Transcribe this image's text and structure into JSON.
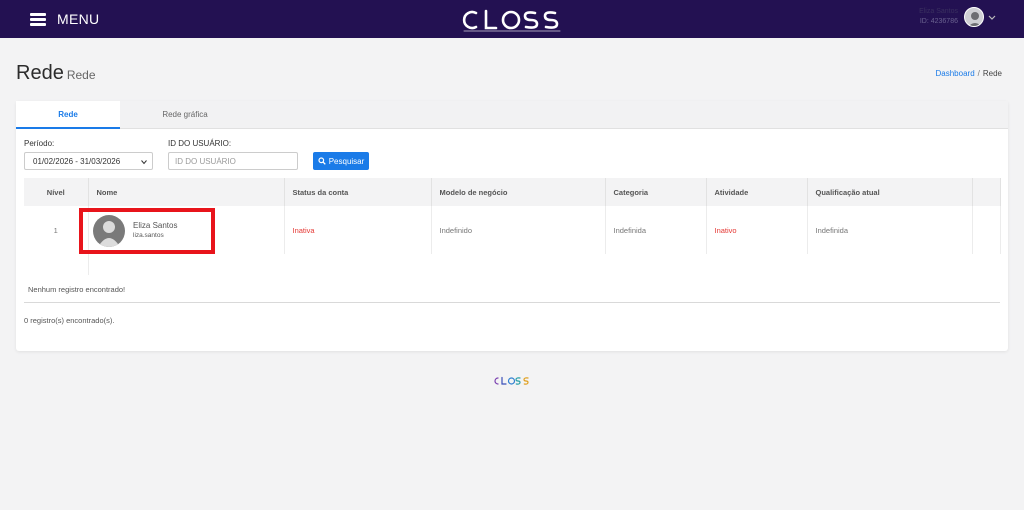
{
  "header": {
    "menu_label": "MENU",
    "brand": "CLOSS",
    "user_name": "Eliza Santos",
    "user_id": "ID: 4236786"
  },
  "page": {
    "title": "Rede",
    "subtitle": "Rede"
  },
  "breadcrumb": {
    "home": "Dashboard",
    "separator": "/",
    "current": "Rede"
  },
  "tabs": [
    {
      "label": "Rede",
      "active": true
    },
    {
      "label": "Rede gráfica",
      "active": false
    }
  ],
  "filters": {
    "period_label": "Período:",
    "period_value": "01/02/2026 - 31/03/2026",
    "user_id_label": "ID DO USUÁRIO:",
    "user_id_placeholder": "ID DO USUÁRIO",
    "search_label": "Pesquisar"
  },
  "table": {
    "headers": [
      "Nível",
      "Nome",
      "Status da conta",
      "Modelo de negócio",
      "Categoria",
      "Atividade",
      "Qualificação atual"
    ],
    "rows": [
      {
        "nivel": "1",
        "nome": "Eliza Santos",
        "usuario": "liza.santos",
        "status": "Inativa",
        "modelo": "Indefinido",
        "categoria": "Indefinida",
        "atividade": "Inativo",
        "qualificacao": "Indefinida"
      }
    ]
  },
  "messages": {
    "empty": "Nenhum registro encontrado!",
    "count": "0 registro(s) encontrado(s)."
  },
  "colors": {
    "topbar": "#231152",
    "accent": "#1a7be8",
    "status_red": "#e53935",
    "highlight": "#e8141b"
  }
}
